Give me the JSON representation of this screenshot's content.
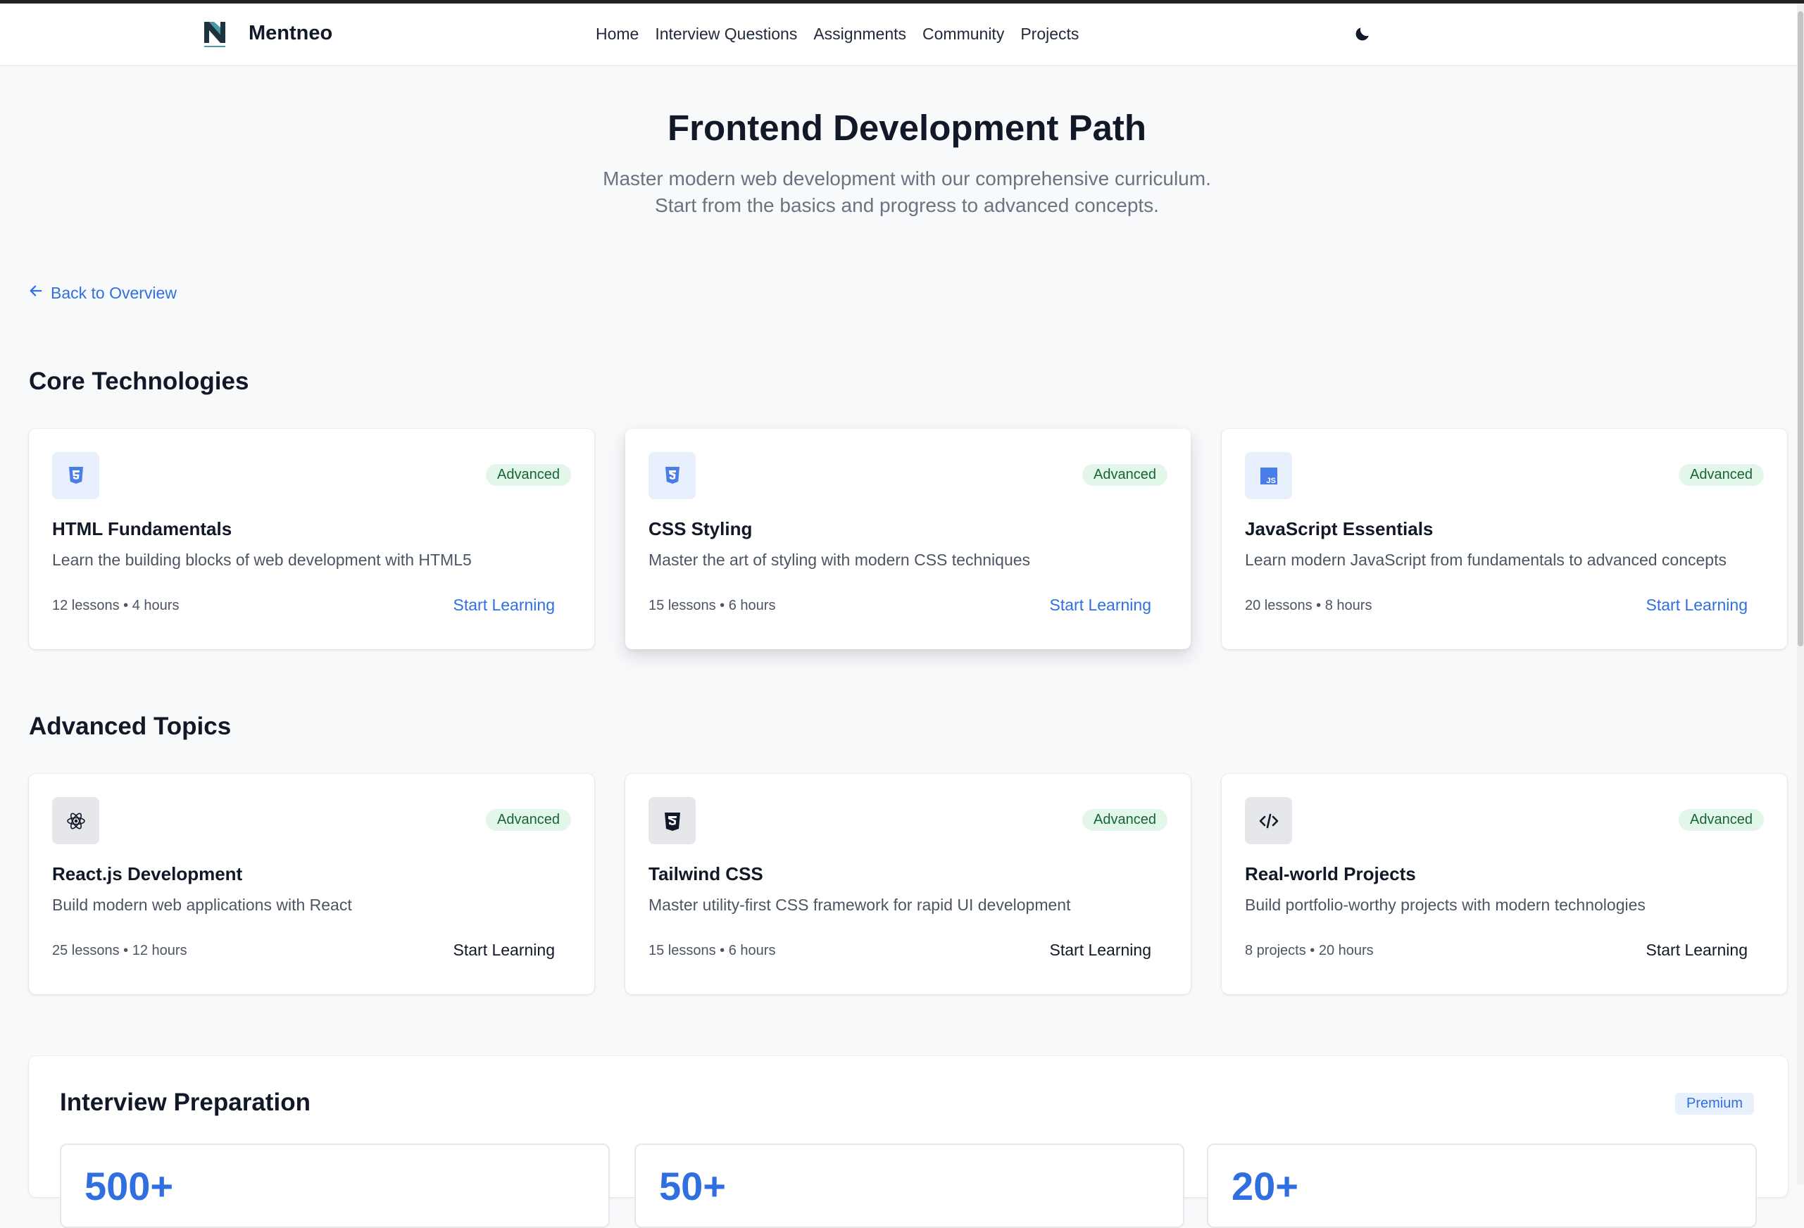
{
  "brand": {
    "name": "Mentneo"
  },
  "nav": {
    "links": [
      "Home",
      "Interview Questions",
      "Assignments",
      "Community",
      "Projects"
    ]
  },
  "hero": {
    "title": "Frontend Development Path",
    "subtitle_line1": "Master modern web development with our comprehensive curriculum.",
    "subtitle_line2": "Start from the basics and progress to advanced concepts."
  },
  "back_link": {
    "label": "Back to Overview"
  },
  "sections": {
    "core": {
      "title": "Core Technologies",
      "cards": [
        {
          "icon": "html5-icon",
          "badge": "Advanced",
          "title": "HTML Fundamentals",
          "description": "Learn the building blocks of web development with HTML5",
          "meta": "12 lessons • 4 hours",
          "cta": "Start Learning"
        },
        {
          "icon": "css3-icon",
          "badge": "Advanced",
          "title": "CSS Styling",
          "description": "Master the art of styling with modern CSS techniques",
          "meta": "15 lessons • 6 hours",
          "cta": "Start Learning"
        },
        {
          "icon": "javascript-icon",
          "badge": "Advanced",
          "title": "JavaScript Essentials",
          "description": "Learn modern JavaScript from fundamentals to advanced concepts",
          "meta": "20 lessons • 8 hours",
          "cta": "Start Learning"
        }
      ]
    },
    "advanced": {
      "title": "Advanced Topics",
      "cards": [
        {
          "icon": "react-icon",
          "badge": "Advanced",
          "title": "React.js Development",
          "description": "Build modern web applications with React",
          "meta": "25 lessons • 12 hours",
          "cta": "Start Learning"
        },
        {
          "icon": "tailwind-css-icon",
          "badge": "Advanced",
          "title": "Tailwind CSS",
          "description": "Master utility-first CSS framework for rapid UI development",
          "meta": "15 lessons • 6 hours",
          "cta": "Start Learning"
        },
        {
          "icon": "code-icon",
          "badge": "Advanced",
          "title": "Real-world Projects",
          "description": "Build portfolio-worthy projects with modern technologies",
          "meta": "8 projects • 20 hours",
          "cta": "Start Learning"
        }
      ]
    }
  },
  "interview_prep": {
    "title": "Interview Preparation",
    "badge": "Premium",
    "stats": [
      "500+",
      "50+",
      "20+"
    ]
  },
  "colors": {
    "accent": "#2f6fe0",
    "badge_green_bg": "#e3f6ea",
    "badge_green_text": "#166534",
    "page_bg": "#f8f9fb"
  },
  "icons": {
    "logo": "mentneo-logo-icon",
    "theme_toggle": "moon-icon",
    "back": "arrow-left-icon"
  }
}
